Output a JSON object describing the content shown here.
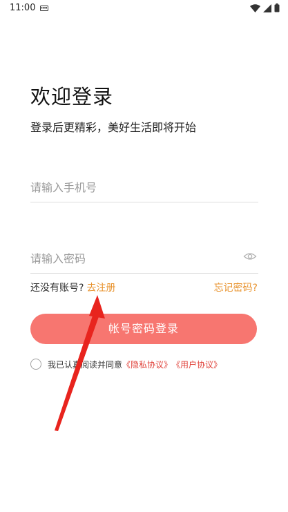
{
  "status": {
    "time": "11:00",
    "icons": [
      "sd-card-icon",
      "wifi-icon",
      "signal-icon",
      "battery-icon"
    ]
  },
  "header": {
    "title": "欢迎登录",
    "subtitle": "登录后更精彩，美好生活即将开始"
  },
  "form": {
    "phone_placeholder": "请输入手机号",
    "password_placeholder": "请输入密码"
  },
  "links": {
    "no_account": "还没有账号?",
    "register": "去注册",
    "forgot": "忘记密码?"
  },
  "login_button": "帐号密码登录",
  "agreement": {
    "prefix": "我已认真阅读并同意",
    "privacy": "《隐私协议》",
    "user": "《用户协议》"
  },
  "colors": {
    "accent": "#f77670",
    "link": "#e8932e",
    "policy": "#e0423a",
    "annotation_arrow": "#e8241e"
  }
}
